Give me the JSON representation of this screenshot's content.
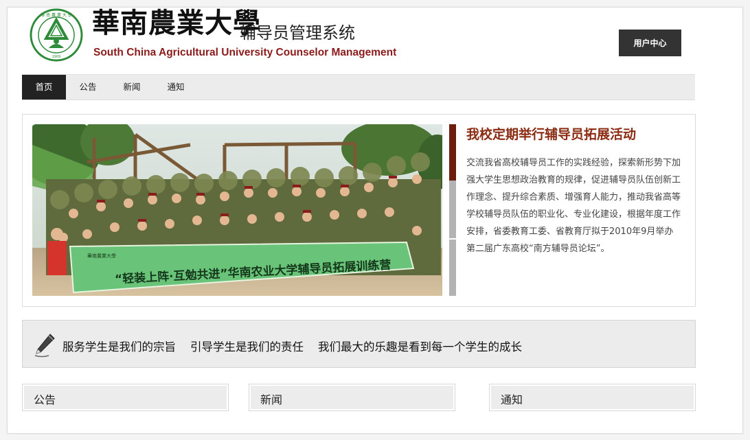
{
  "header": {
    "logo_seal_text": "華南農業大學 SOUTH CHINA AGRICULTURAL UNIVERSITY 1909",
    "logo_cn": "華南農業大學",
    "logo_system": "辅导员管理系统",
    "logo_en": "South China Agricultural University  Counselor Management",
    "user_center": "用户中心"
  },
  "nav": {
    "items": [
      {
        "label": "首页",
        "active": true
      },
      {
        "label": "公告",
        "active": false
      },
      {
        "label": "新闻",
        "active": false
      },
      {
        "label": "通知",
        "active": false
      }
    ]
  },
  "feature": {
    "title": "我校定期举行辅导员拓展活动",
    "text": "交流我省高校辅导员工作的实践经验，探索新形势下加强大学生思想政治教育的规律，促进辅导员队伍创新工作理念、提升综合素质、增强育人能力，推动我省高等学校辅导员队伍的职业化、专业化建设，根据年度工作安排，省委教育工委、省教育厅拟于2010年9月举办第二届广东高校“南方辅导员论坛”。",
    "photo_banner": "“轻装上阵·互勉共进”华南农业大学辅导员拓展训练营",
    "photo_banner_small": "華南農業大學"
  },
  "motto": {
    "text": "服务学生是我们的宗旨    引导学生是我们的责任    我们最大的乐趣是看到每一个学生的成长"
  },
  "panels": [
    {
      "title": "公告"
    },
    {
      "title": "新闻"
    },
    {
      "title": "通知"
    }
  ],
  "colors": {
    "accent_dark": "#222222",
    "title_red": "#8a2b12",
    "scroll_thumb": "#6d1d0c",
    "logo_green": "#2e8b3a",
    "logo_en_red": "#8b1a1a"
  }
}
